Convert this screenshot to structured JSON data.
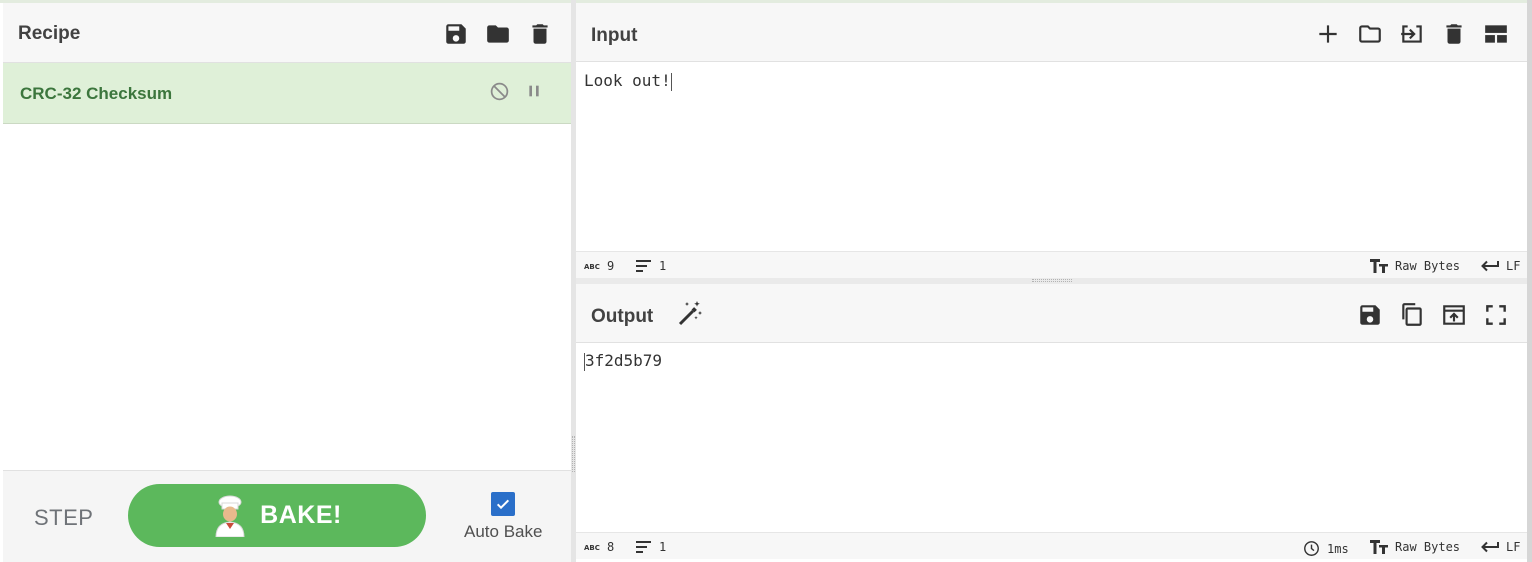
{
  "recipe": {
    "title": "Recipe",
    "header_icons": [
      "save-icon",
      "folder-icon",
      "trash-icon"
    ],
    "operations": [
      {
        "name": "CRC-32 Checksum",
        "controls": [
          "disable-icon",
          "breakpoint-icon"
        ]
      }
    ],
    "step_label": "STEP",
    "bake_label": "BAKE!",
    "auto_bake_label": "Auto Bake",
    "auto_bake_checked": true
  },
  "input": {
    "title": "Input",
    "header_icons": [
      "plus-icon",
      "folder-icon",
      "import-icon",
      "trash-icon",
      "layout-icon"
    ],
    "text": "Look out!",
    "status": {
      "char_count": "9",
      "line_count": "1",
      "encoding": "Raw Bytes",
      "eol": "LF"
    }
  },
  "output": {
    "title": "Output",
    "header_icons": [
      "magic-wand-icon",
      "save-icon",
      "copy-icon",
      "replace-input-icon",
      "maximize-icon"
    ],
    "text": "3f2d5b79",
    "status": {
      "char_count": "8",
      "line_count": "1",
      "bake_time": "1ms",
      "encoding": "Raw Bytes",
      "eol": "LF"
    }
  },
  "colors": {
    "operation_bg": "#dff0d8",
    "operation_text": "#3c763d",
    "bake_button": "#5cb85c",
    "checkbox": "#2a6fc9"
  }
}
